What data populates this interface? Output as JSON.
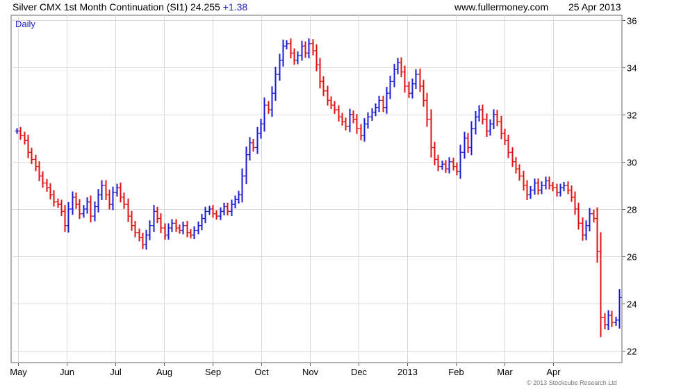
{
  "header": {
    "title": "Silver CMX 1st Month Continuation (SI1)",
    "price": "24.255",
    "change": "+1.38",
    "site": "www.fullermoney.com",
    "date": "25 Apr 2013"
  },
  "footer": {
    "copyright": "© 2013 Stockcube Research Ltd"
  },
  "chart_data": {
    "type": "ohlc",
    "timeframe_label": "Daily",
    "y_axis": {
      "position": "right",
      "ylim": [
        21.5,
        36.2
      ],
      "ticks": [
        22,
        24,
        26,
        28,
        30,
        32,
        34,
        36
      ]
    },
    "x_axis": {
      "labels": [
        "May",
        "Jun",
        "Jul",
        "Aug",
        "Sep",
        "Oct",
        "Nov",
        "Dec",
        "2013",
        "Feb",
        "Mar",
        "Apr"
      ]
    },
    "grid": true,
    "colors": {
      "up": "#1a1ad6",
      "down": "#e01010",
      "grid": "#d8d8d8",
      "frame": "#666666"
    },
    "series": [
      {
        "values": [
          31.3,
          31.1,
          30.9,
          30.4,
          30.1,
          29.8,
          29.4,
          29.1,
          28.9,
          28.6,
          28.3,
          28.2,
          27.9,
          27.3,
          28.0,
          28.5,
          28.2,
          27.8,
          28.0,
          28.3,
          27.7,
          28.1,
          28.6,
          29.0,
          28.6,
          28.2,
          28.7,
          28.9,
          28.5,
          28.2,
          27.7,
          27.3,
          27.0,
          26.8,
          26.5,
          26.9,
          27.3,
          27.9,
          27.6,
          27.2,
          26.9,
          27.2,
          27.4,
          27.2,
          27.1,
          27.3,
          27.0,
          26.9,
          27.1,
          27.3,
          27.6,
          27.9,
          28.0,
          27.8,
          27.7,
          27.9,
          28.1,
          27.9,
          28.2,
          28.4,
          28.6,
          29.4,
          30.3,
          30.8,
          30.6,
          31.2,
          31.6,
          32.4,
          32.2,
          32.9,
          33.7,
          34.3,
          34.9,
          35.0,
          34.6,
          34.3,
          34.5,
          34.9,
          34.6,
          35.0,
          34.7,
          34.1,
          33.4,
          33.0,
          32.6,
          32.4,
          32.2,
          31.9,
          31.7,
          31.5,
          32.0,
          31.8,
          31.4,
          31.1,
          31.6,
          31.9,
          32.1,
          32.3,
          32.6,
          32.3,
          32.9,
          33.4,
          33.9,
          34.2,
          33.8,
          33.2,
          32.9,
          33.3,
          33.7,
          33.2,
          32.6,
          31.8,
          30.6,
          30.1,
          29.8,
          29.9,
          29.7,
          30.0,
          29.8,
          29.6,
          30.4,
          31.0,
          30.6,
          31.4,
          31.9,
          32.2,
          31.8,
          31.3,
          31.6,
          32.0,
          31.7,
          31.2,
          30.9,
          30.4,
          30.0,
          29.7,
          29.4,
          29.0,
          28.6,
          28.8,
          29.1,
          28.8,
          29.0,
          29.2,
          29.0,
          28.9,
          28.7,
          28.9,
          29.0,
          28.8,
          28.5,
          28.0,
          27.4,
          26.9,
          27.3,
          27.8,
          27.6,
          26.2,
          23.4,
          23.1,
          23.5,
          23.2,
          23.3,
          24.255
        ]
      }
    ]
  }
}
